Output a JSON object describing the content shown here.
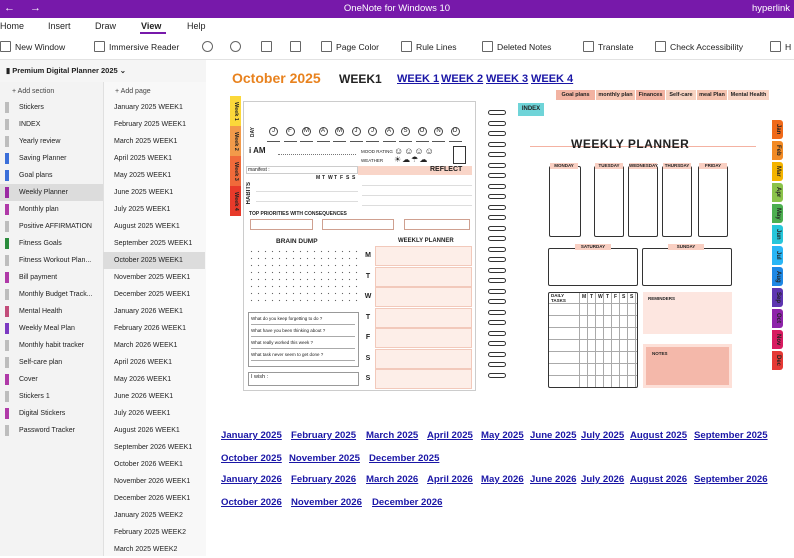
{
  "titlebar": {
    "title": "OneNote for Windows 10",
    "right": "hyperlink"
  },
  "menu": {
    "home": "Home",
    "insert": "Insert",
    "draw": "Draw",
    "view": "View",
    "help": "Help"
  },
  "ribbon": {
    "new_window": "New Window",
    "immersive": "Immersive Reader",
    "page_color": "Page Color",
    "rule_lines": "Rule Lines",
    "deleted": "Deleted Notes",
    "translate": "Translate",
    "check": "Check Accessibility"
  },
  "notebook": {
    "title": "Premium Digital Planner 2025",
    "add_section": "+ Add section",
    "add_page": "+ Add page"
  },
  "sections": [
    {
      "label": "Stickers",
      "color": ""
    },
    {
      "label": "INDEX",
      "color": ""
    },
    {
      "label": "Yearly review",
      "color": ""
    },
    {
      "label": "Saving Planner",
      "color": "#3b6fd9"
    },
    {
      "label": "Goal plans",
      "color": "#3b6fd9"
    },
    {
      "label": "Weekly Planner",
      "color": "#9b2aa3"
    },
    {
      "label": "Monthly plan",
      "color": "#b03aa8"
    },
    {
      "label": "Positive AFFIRMATION",
      "color": ""
    },
    {
      "label": "Fitness Goals",
      "color": "#2a8c3c"
    },
    {
      "label": "Fitness Workout Plan...",
      "color": ""
    },
    {
      "label": "Bill payment",
      "color": "#b03aa8"
    },
    {
      "label": "Monthly Budget Track...",
      "color": ""
    },
    {
      "label": "Mental Health",
      "color": "#c24d7a"
    },
    {
      "label": "Weekly Meal Plan",
      "color": "#7c3ac2"
    },
    {
      "label": "Monthly habit tracker",
      "color": ""
    },
    {
      "label": "Self-care plan",
      "color": ""
    },
    {
      "label": "Cover",
      "color": "#b03aa8"
    },
    {
      "label": "Stickers 1",
      "color": ""
    },
    {
      "label": "Digital Stickers",
      "color": "#b03aa8"
    },
    {
      "label": "Password Tracker",
      "color": ""
    }
  ],
  "pages": [
    "January 2025 WEEK1",
    "February 2025 WEEK1",
    "March 2025 WEEK1",
    "April 2025 WEEK1",
    "May 2025 WEEK1",
    "June 2025 WEEK1",
    "July 2025 WEEK1",
    "August 2025 WEEK1",
    "September 2025 WEEK1",
    "October 2025 WEEK1",
    "November 2025 WEEK1",
    "December 2025 WEEK1",
    "January 2026 WEEK1",
    "February 2026 WEEK1",
    "March 2026 WEEK1",
    "April 2026 WEEK1",
    "May 2026 WEEK1",
    "June 2026 WEEK1",
    "July 2026 WEEK1",
    "August 2026 WEEK1",
    "September 2026 WEEK1",
    "October 2026 WEEK1",
    "November 2026 WEEK1",
    "December 2026 WEEK1",
    "January 2025 WEEK2",
    "February 2025 WEEK2",
    "March 2025 WEEK2"
  ],
  "header": {
    "title": "October 2025",
    "week": "WEEK1",
    "nav": [
      "WEEK 1",
      "WEEK 2",
      "WEEK 3",
      "WEEK 4"
    ]
  },
  "tags": [
    "Goal plans",
    "monthly plan",
    "Finances",
    "Self-care",
    "meal Plan",
    "Mental Health"
  ],
  "planner": {
    "week_tabs": [
      "Week 1",
      "Week 2",
      "Week 3",
      "Week 4"
    ],
    "months_letters": [
      "J",
      "F",
      "M",
      "A",
      "M",
      "J",
      "J",
      "A",
      "S",
      "O",
      "N",
      "D"
    ],
    "i_am": "i AM",
    "day_label": "DAY",
    "mood": "MOOD RATING",
    "weather": "WEATHER",
    "manifest": "manifest :",
    "reflect": "REFLECT",
    "habits": "HABITS",
    "habit_days": [
      "M",
      "T",
      "W",
      "T",
      "F",
      "S",
      "S"
    ],
    "priorities": "TOP PRIORITIES WITH CONSEQUENCES",
    "brain_dump": "BRAIN DUMP",
    "weekly_planner": "WEEKLY PLANNER",
    "day_letters": [
      "M",
      "T",
      "W",
      "T",
      "F",
      "S",
      "S"
    ],
    "prompts": [
      "What do you keep forgetting to do ?",
      "What have you been thinking about ?",
      "What really worked this week ?",
      "What task never seem to get done ?"
    ],
    "i_wish": "I wish :"
  },
  "right": {
    "index": "INDEX",
    "title": "WEEKLY PLANNER",
    "days": [
      "MONDAY",
      "TUESDAY",
      "WEDNESDAY",
      "THURSDAY",
      "FRIDAY"
    ],
    "weekend": [
      "SATURDAY",
      "SUNDAY"
    ],
    "daily_tasks": "DAILY TASKS",
    "task_days": [
      "M",
      "T",
      "W",
      "T",
      "F",
      "S",
      "S"
    ],
    "reminders": "REMINDERS",
    "notes": "NOTES"
  },
  "month_tabs": [
    {
      "label": "Jan",
      "color": "#f06a1a"
    },
    {
      "label": "Feb",
      "color": "#f28a24"
    },
    {
      "label": "Mar",
      "color": "#f4b400"
    },
    {
      "label": "Apr",
      "color": "#8bc34a"
    },
    {
      "label": "May",
      "color": "#4caf50"
    },
    {
      "label": "Jun",
      "color": "#26c6da"
    },
    {
      "label": "Jul",
      "color": "#29b6f6"
    },
    {
      "label": "Aug",
      "color": "#1e88e5"
    },
    {
      "label": "Sep",
      "color": "#5e35b1"
    },
    {
      "label": "Oct",
      "color": "#8e24aa"
    },
    {
      "label": "Nov",
      "color": "#d81b60"
    },
    {
      "label": "Dec",
      "color": "#e53935"
    }
  ],
  "links_2025": [
    "January 2025",
    "February 2025",
    "March 2025",
    "April 2025",
    "May 2025",
    "June 2025",
    "July 2025",
    "August 2025",
    "September 2025"
  ],
  "links_2025b": [
    "October 2025",
    "November 2025",
    "December 2025"
  ],
  "links_2026": [
    "January 2026",
    "February 2026",
    "March 2026",
    "April 2026",
    "May 2026",
    "June 2026",
    "July 2026",
    "August 2026",
    "September 2026"
  ],
  "links_2026b": [
    "October 2026",
    "November 2026",
    "December 2026"
  ]
}
